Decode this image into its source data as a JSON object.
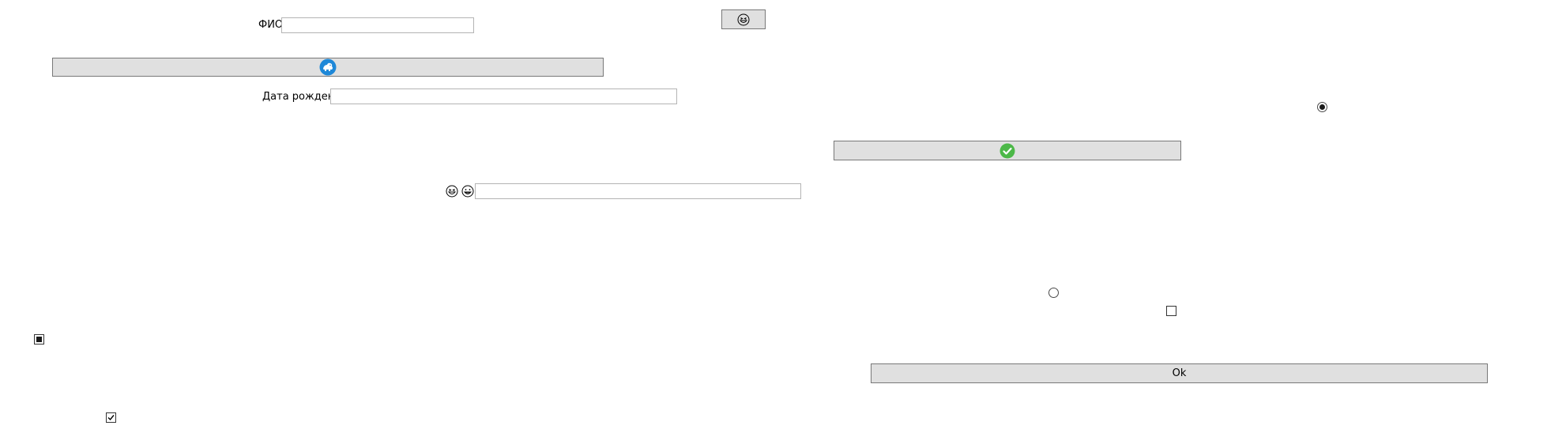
{
  "form": {
    "fio_label": "ФИО",
    "fio_value": "",
    "birthdate_label": "Дата рождения",
    "birthdate_value": "",
    "emoji_field_value": "",
    "ok_button_label": "Ok"
  },
  "icons": {
    "top_button_icon": "grinning-squint-emoji-icon",
    "wide_button_icon": "blue-animal-logo-icon",
    "confirm_button_icon": "green-check-circle-icon",
    "field_icon_1": "grinning-squint-emoji-icon",
    "field_icon_2": "grinning-emoji-icon"
  },
  "controls": {
    "radio_1_checked": true,
    "radio_2_checked": false,
    "checkbox_1_state": "unchecked",
    "checkbox_2_state": "indeterminate",
    "checkbox_3_state": "checked"
  },
  "colors": {
    "button_bg": "#e0e0e0",
    "button_border": "#787878",
    "check_green": "#4cb848",
    "logo_blue": "#1e88d8"
  }
}
